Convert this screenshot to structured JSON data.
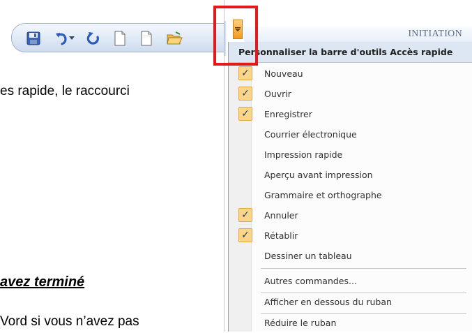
{
  "toolbar": {
    "buttons": [
      {
        "name": "save-icon",
        "label": "Enregistrer"
      },
      {
        "name": "undo-icon",
        "label": "Annuler"
      },
      {
        "name": "undo-dropdown-icon",
        "label": ""
      },
      {
        "name": "redo-icon",
        "label": "Rétablir"
      },
      {
        "name": "new-document-icon",
        "label": "Nouveau"
      },
      {
        "name": "blank-page-icon",
        "label": ""
      },
      {
        "name": "open-folder-icon",
        "label": "Ouvrir"
      }
    ]
  },
  "document": {
    "line1": "es rapide, le raccourci",
    "heading": "avez terminé",
    "line3": "Vord si vous n’avez pas"
  },
  "ribbon": {
    "tab_label": "INITIATION"
  },
  "menu": {
    "header": "Personnaliser la barre d'outils Accès rapide",
    "items": [
      {
        "label": "Nouveau",
        "checked": true
      },
      {
        "label": "Ouvrir",
        "checked": true
      },
      {
        "label": "Enregistrer",
        "checked": true
      },
      {
        "label": "Courrier électronique",
        "checked": false
      },
      {
        "label": "Impression rapide",
        "checked": false
      },
      {
        "label": "Aperçu avant impression",
        "checked": false
      },
      {
        "label": "Grammaire et orthographe",
        "checked": false
      },
      {
        "label": "Annuler",
        "checked": true
      },
      {
        "label": "Rétablir",
        "checked": true
      },
      {
        "label": "Dessiner un tableau",
        "checked": false
      },
      {
        "label": "Autres commandes...",
        "checked": false
      },
      {
        "label": "Afficher en dessous du ruban",
        "checked": false
      },
      {
        "label": "Réduire le ruban",
        "checked": false
      }
    ]
  },
  "colors": {
    "highlight_box": "#e11b1b",
    "check_bg": "#fbd68a",
    "dropdown_arrow": "#f39a1e"
  }
}
